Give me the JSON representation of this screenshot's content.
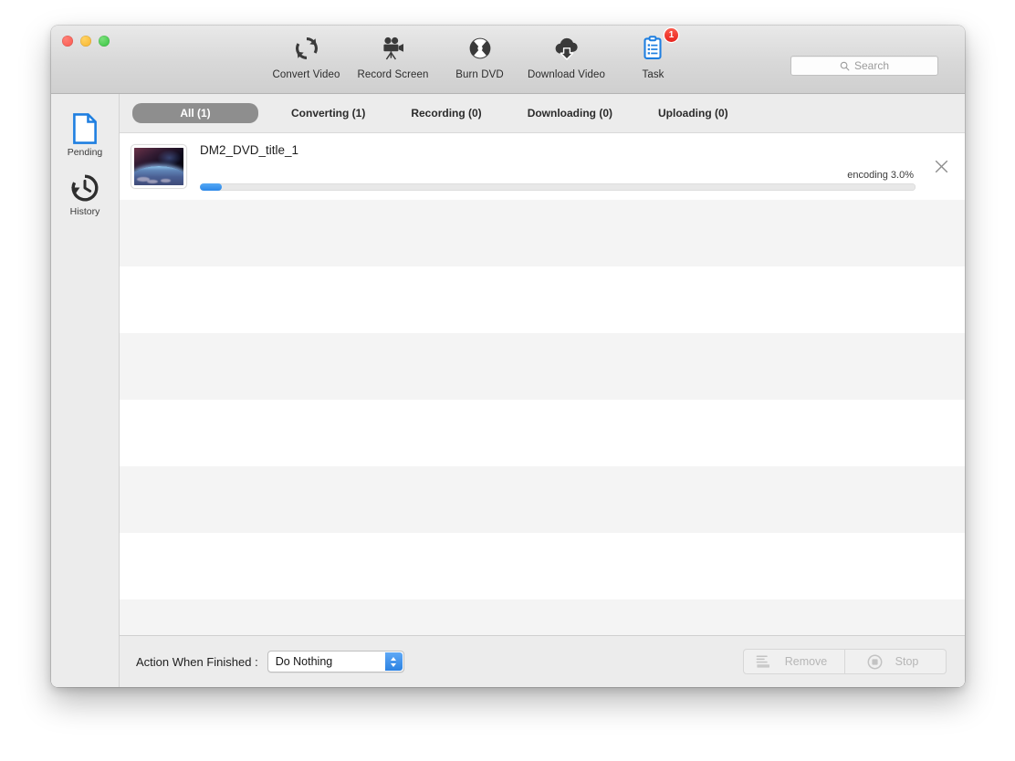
{
  "window": {
    "traffic_lights": [
      "close",
      "minimize",
      "zoom"
    ],
    "accent_blue": "#2b87e8",
    "badge_red": "#e8231c"
  },
  "toolbar": {
    "items": [
      {
        "label": "Convert Video",
        "icon": "convert-video-icon",
        "active": false
      },
      {
        "label": "Record Screen",
        "icon": "record-screen-icon",
        "active": false
      },
      {
        "label": "Burn DVD",
        "icon": "burn-dvd-icon",
        "active": false
      },
      {
        "label": "Download Video",
        "icon": "download-video-icon",
        "active": false
      },
      {
        "label": "Task",
        "icon": "task-icon",
        "active": true,
        "badge": "1"
      }
    ],
    "search": {
      "placeholder": "Search",
      "value": "",
      "icon": "search-icon"
    }
  },
  "sidebar": {
    "items": [
      {
        "label": "Pending",
        "icon": "document-icon",
        "selected": true
      },
      {
        "label": "History",
        "icon": "clock-history-icon",
        "selected": false
      }
    ]
  },
  "tabs": [
    {
      "label": "All (1)",
      "selected": true
    },
    {
      "label": "Converting (1)",
      "selected": false
    },
    {
      "label": "Recording (0)",
      "selected": false
    },
    {
      "label": "Downloading (0)",
      "selected": false
    },
    {
      "label": "Uploading (0)",
      "selected": false
    }
  ],
  "tasks": [
    {
      "name": "DM2_DVD_title_1",
      "status": "encoding 3.0%",
      "progress_percent": 3.0,
      "thumbnail": "earth-from-space-thumbnail",
      "close_icon": "close-icon"
    }
  ],
  "empty_rows": 7,
  "footer": {
    "action_label": "Action When Finished :",
    "action_select": {
      "value": "Do Nothing",
      "options": [
        "Do Nothing"
      ]
    },
    "buttons": [
      {
        "label": "Remove",
        "icon": "remove-list-icon",
        "enabled": false
      },
      {
        "label": "Stop",
        "icon": "stop-circle-icon",
        "enabled": false
      }
    ]
  }
}
